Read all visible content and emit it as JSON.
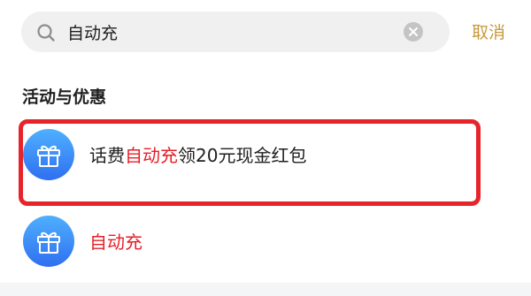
{
  "search": {
    "query": "自动充",
    "cancel_label": "取消"
  },
  "section": {
    "title": "活动与优惠"
  },
  "results": [
    {
      "prefix": "话费",
      "highlight": "自动充",
      "suffix": "领20元现金红包",
      "selected": true
    },
    {
      "prefix": "",
      "highlight": "自动充",
      "suffix": "",
      "selected": false
    }
  ],
  "colors": {
    "highlight_text": "#e61f27",
    "selection_border": "#e8242b",
    "cancel_text": "#c89a3b",
    "icon_gradient_top": "#4fb0ff",
    "icon_gradient_bottom": "#2f6ff0"
  }
}
